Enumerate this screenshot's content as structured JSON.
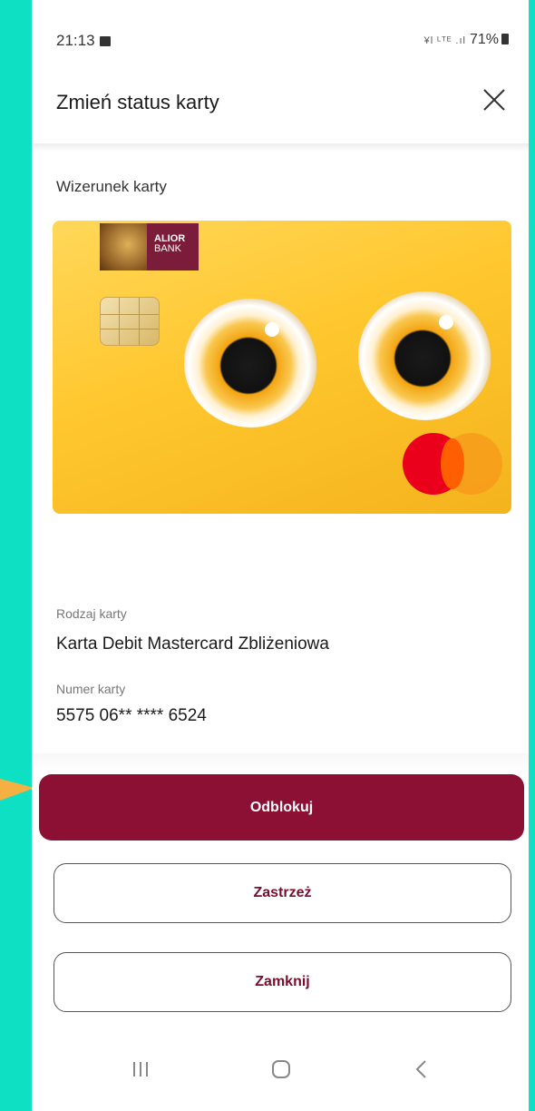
{
  "status_bar": {
    "time": "21:13",
    "mini_icons": "¥l ᴸᵀᴱ .ıl",
    "battery": "71%"
  },
  "header": {
    "title": "Zmień status karty"
  },
  "card_section": {
    "label": "Wizerunek karty",
    "logo_text": [
      "ALIOR",
      "BANK"
    ]
  },
  "card_info": {
    "type_label": "Rodzaj karty",
    "type_value": "Karta Debit Mastercard Zbliżeniowa",
    "number_label": "Numer karty",
    "number_value": "5575 06** **** 6524"
  },
  "actions": {
    "unblock": "Odblokuj",
    "reserve": "Zastrzeż",
    "close": "Zamknij"
  },
  "colors": {
    "accent": "#8b1033",
    "background": "#0ee0c4",
    "arrow": "#f5b041"
  },
  "nav_bar": {
    "icons": [
      "recent-apps-icon",
      "home-icon",
      "back-icon"
    ]
  }
}
